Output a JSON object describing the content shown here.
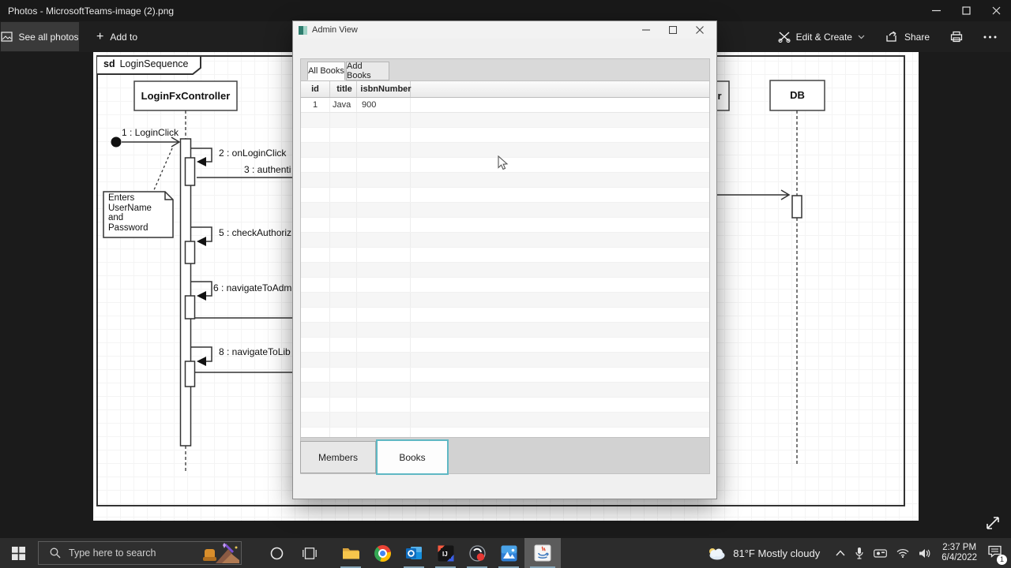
{
  "photos_app": {
    "title": "Photos - MicrosoftTeams-image (2).png",
    "toolbar": {
      "see_all_photos": "See all photos",
      "add_to": "Add to",
      "plus": "+",
      "edit_create": "Edit & Create",
      "share": "Share"
    }
  },
  "diagram": {
    "frame": {
      "keyword": "sd",
      "name": "LoginSequence"
    },
    "lifelines": {
      "controller": "LoginFxController",
      "db": "DB",
      "clipped_lifeline_fragment": "r"
    },
    "messages": {
      "m1": "1 : LoginClick",
      "m2": "2 : onLoginClick",
      "m3": "3 : authenti",
      "m5": "5 : checkAuthoriz",
      "m6": "6 : navigateToAdm",
      "m8": "8 : navigateToLib"
    },
    "note": [
      "Enters",
      "UserName",
      "and",
      "Password"
    ]
  },
  "admin_window": {
    "title": "Admin View",
    "tabs": {
      "all_books": "All Books",
      "add_books": "Add Books"
    },
    "table": {
      "headers": [
        "id",
        "title",
        "isbnNumber"
      ],
      "rows": [
        [
          "1",
          "Java",
          "900"
        ]
      ]
    },
    "bottom_tabs": {
      "members": "Members",
      "books": "Books"
    },
    "accent_color": "#5fb8c4"
  },
  "taskbar": {
    "search_placeholder": "Type here to search",
    "weather": {
      "temp": "81°F",
      "condition": "Mostly cloudy"
    },
    "clock": {
      "time": "2:37 PM",
      "date": "6/4/2022"
    },
    "notification_count": "1"
  }
}
